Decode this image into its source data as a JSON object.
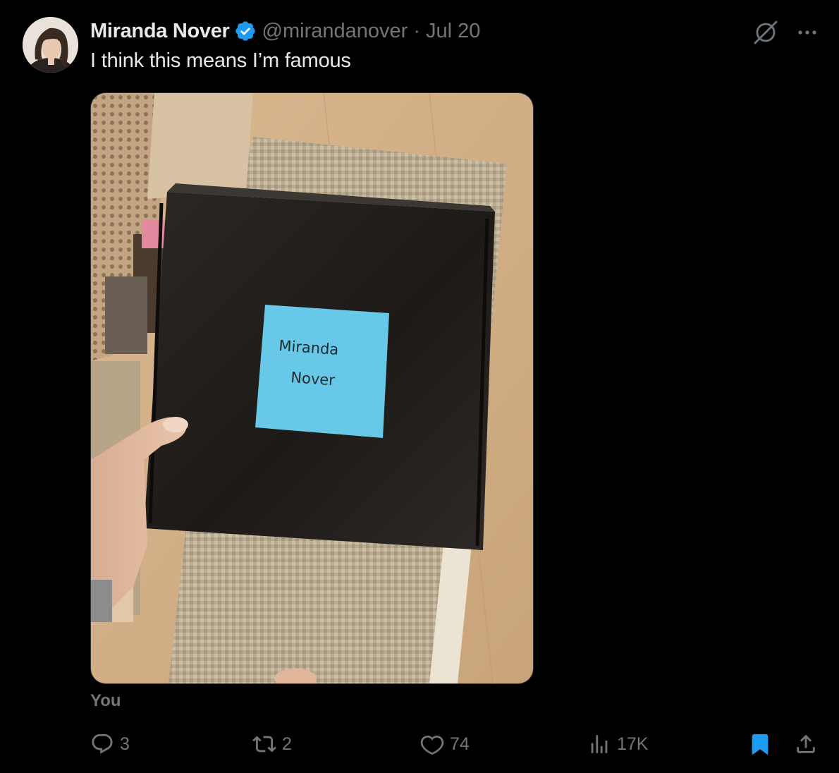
{
  "tweet": {
    "display_name": "Miranda Nover",
    "handle": "@mirandanover",
    "separator": "·",
    "date": "Jul 20",
    "text": "I think this means I’m famous",
    "verified": true
  },
  "media": {
    "note_line1": "Miranda",
    "note_line2": "Nover",
    "caption_label": "You"
  },
  "actions": {
    "replies": "3",
    "retweets": "2",
    "likes": "74",
    "views": "17K",
    "bookmarked": true
  },
  "icons": {
    "verified": "verified-badge-icon",
    "grok": "grok-icon",
    "more": "more-icon",
    "reply": "reply-icon",
    "retweet": "retweet-icon",
    "like": "heart-icon",
    "views": "analytics-icon",
    "bookmark": "bookmark-icon",
    "share": "share-icon"
  },
  "colors": {
    "background": "#000000",
    "text_primary": "#e7e9ea",
    "text_secondary": "#71767b",
    "verified_blue": "#1d9bf0",
    "bookmark_blue": "#1d9bf0",
    "sticky_note": "#68c8e8"
  }
}
